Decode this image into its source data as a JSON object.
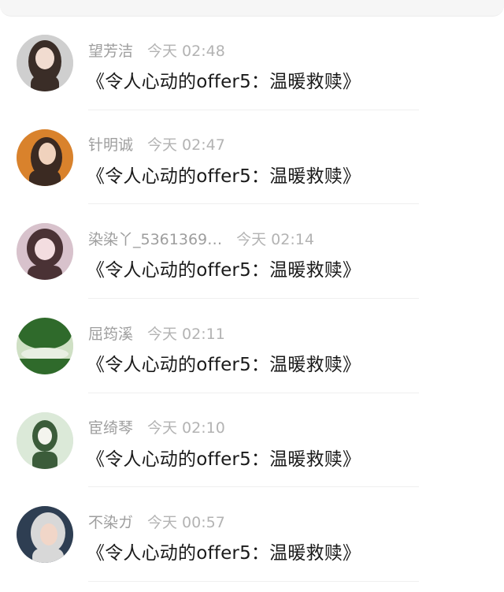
{
  "comments": [
    {
      "username": "望芳洁",
      "time": "今天 02:48",
      "text": "《令人心动的offer5：温暖救赎》",
      "avatar_icon": "girl-portrait-avatar",
      "avatar_colors": [
        "#cfcfcf",
        "#3a2d27",
        "#f1dcd0"
      ]
    },
    {
      "username": "针明诚",
      "time": "今天 02:47",
      "text": "《令人心动的offer5：温暖救赎》",
      "avatar_icon": "girl-orange-background-avatar",
      "avatar_colors": [
        "#d9822c",
        "#3b2a22",
        "#f0d2bd"
      ]
    },
    {
      "username": "染染丫_5361369…",
      "time": "今天 02:14",
      "text": "《令人心动的offer5：温暖救赎》",
      "avatar_icon": "anime-cat-girl-avatar",
      "avatar_colors": [
        "#d8c2cc",
        "#4a3235",
        "#f3dde0"
      ]
    },
    {
      "username": "屈筠溪",
      "time": "今天 02:11",
      "text": "《令人心动的offer5：温暖救赎》",
      "avatar_icon": "green-trees-avatar",
      "avatar_colors": [
        "#cfe0c4",
        "#2f6a2b",
        "#e8efe2"
      ]
    },
    {
      "username": "宦绮琴",
      "time": "今天 02:10",
      "text": "《令人心动的offer5：温暖救赎》",
      "avatar_icon": "ancient-style-figure-avatar",
      "avatar_colors": [
        "#dbe9d8",
        "#3b5c3a",
        "#f4f4ee"
      ]
    },
    {
      "username": "不染ガ",
      "time": "今天 00:57",
      "text": "《令人心动的offer5：温暖救赎》",
      "avatar_icon": "hooded-girl-avatar",
      "avatar_colors": [
        "#2e3e52",
        "#d8d8d8",
        "#f1d6c8"
      ]
    }
  ]
}
